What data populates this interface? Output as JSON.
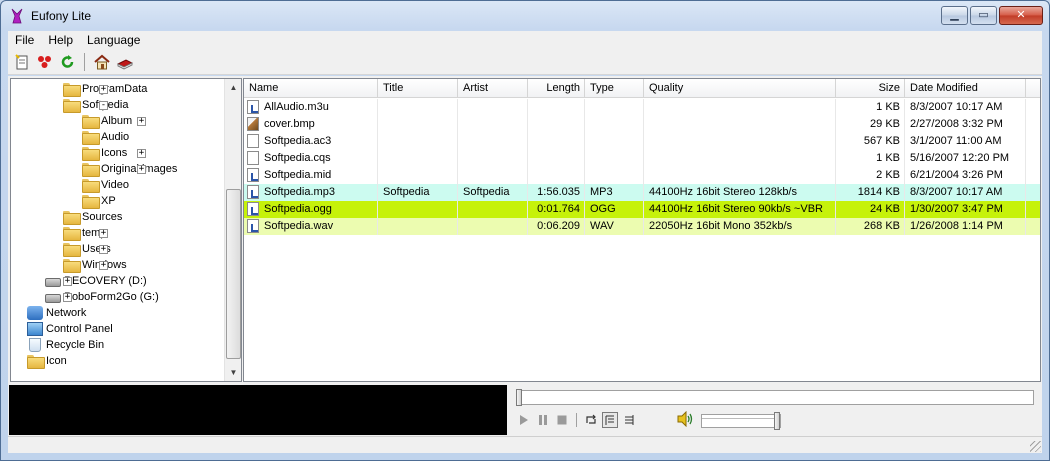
{
  "window": {
    "title": "Eufony Lite",
    "app_icon": "rabbit-icon"
  },
  "menu": [
    "File",
    "Help",
    "Language"
  ],
  "toolbar": [
    {
      "name": "new-playlist-icon"
    },
    {
      "name": "record-dots-icon"
    },
    {
      "name": "refresh-icon"
    },
    {
      "name": "home-icon"
    },
    {
      "name": "book-icon"
    }
  ],
  "tree": [
    {
      "label": "ProgramData",
      "level": 3,
      "icon": "folder",
      "expander": "+"
    },
    {
      "label": "Softpedia",
      "level": 3,
      "icon": "folder",
      "expander": "-"
    },
    {
      "label": "Album",
      "level": 4,
      "icon": "folder",
      "expander": "+"
    },
    {
      "label": "Audio",
      "level": 4,
      "icon": "folder",
      "expander": ""
    },
    {
      "label": "Icons",
      "level": 4,
      "icon": "folder",
      "expander": "+"
    },
    {
      "label": "Original images",
      "level": 4,
      "icon": "folder",
      "expander": "+"
    },
    {
      "label": "Video",
      "level": 4,
      "icon": "folder",
      "expander": ""
    },
    {
      "label": "XP",
      "level": 4,
      "icon": "folder",
      "expander": ""
    },
    {
      "label": "Sources",
      "level": 3,
      "icon": "folder",
      "expander": ""
    },
    {
      "label": "temp",
      "level": 3,
      "icon": "folder",
      "expander": "+"
    },
    {
      "label": "Users",
      "level": 3,
      "icon": "folder",
      "expander": "+"
    },
    {
      "label": "Windows",
      "level": 3,
      "icon": "folder",
      "expander": "+"
    },
    {
      "label": "RECOVERY (D:)",
      "level": 2,
      "icon": "drive",
      "expander": "+"
    },
    {
      "label": "RoboForm2Go (G:)",
      "level": 2,
      "icon": "drive",
      "expander": "+"
    },
    {
      "label": "Network",
      "level": 1,
      "icon": "network",
      "expander": "+"
    },
    {
      "label": "Control Panel",
      "level": 1,
      "icon": "control-panel",
      "expander": "+"
    },
    {
      "label": "Recycle Bin",
      "level": 1,
      "icon": "recycle-bin",
      "expander": ""
    },
    {
      "label": "Icon",
      "level": 1,
      "icon": "folder",
      "expander": ""
    }
  ],
  "columns": [
    "Name",
    "Title",
    "Artist",
    "Length",
    "Type",
    "Quality",
    "Size",
    "Date Modified"
  ],
  "files": [
    {
      "name": "AllAudio.m3u",
      "title": "",
      "artist": "",
      "length": "",
      "type": "",
      "quality": "",
      "size": "1 KB",
      "date": "8/3/2007 10:17 AM",
      "icon": "audio",
      "highlight": ""
    },
    {
      "name": "cover.bmp",
      "title": "",
      "artist": "",
      "length": "",
      "type": "",
      "quality": "",
      "size": "29 KB",
      "date": "2/27/2008 3:32 PM",
      "icon": "image",
      "highlight": ""
    },
    {
      "name": "Softpedia.ac3",
      "title": "",
      "artist": "",
      "length": "",
      "type": "",
      "quality": "",
      "size": "567 KB",
      "date": "3/1/2007 11:00 AM",
      "icon": "blank",
      "highlight": ""
    },
    {
      "name": "Softpedia.cqs",
      "title": "",
      "artist": "",
      "length": "",
      "type": "",
      "quality": "",
      "size": "1 KB",
      "date": "5/16/2007 12:20 PM",
      "icon": "blank",
      "highlight": ""
    },
    {
      "name": "Softpedia.mid",
      "title": "",
      "artist": "",
      "length": "",
      "type": "",
      "quality": "",
      "size": "2 KB",
      "date": "6/21/2004 3:26 PM",
      "icon": "audio",
      "highlight": ""
    },
    {
      "name": "Softpedia.mp3",
      "title": "Softpedia",
      "artist": "Softpedia",
      "length": "1:56.035",
      "type": "MP3",
      "quality": "44100Hz 16bit Stereo 128kb/s",
      "size": "1814 KB",
      "date": "8/3/2007 10:17 AM",
      "icon": "audio",
      "highlight": "#ccfbf0"
    },
    {
      "name": "Softpedia.ogg",
      "title": "",
      "artist": "",
      "length": "0:01.764",
      "type": "OGG",
      "quality": "44100Hz 16bit Stereo 90kb/s ~VBR",
      "size": "24 KB",
      "date": "1/30/2007 3:47 PM",
      "icon": "audio",
      "highlight": "#c6f20a"
    },
    {
      "name": "Softpedia.wav",
      "title": "",
      "artist": "",
      "length": "0:06.209",
      "type": "WAV",
      "quality": "22050Hz 16bit Mono 352kb/s",
      "size": "268 KB",
      "date": "1/26/2008 1:14 PM",
      "icon": "audio",
      "highlight": "#ecfcb0"
    }
  ],
  "player": {
    "seek_position": 0,
    "volume": 1.0,
    "controls": [
      "play-icon",
      "pause-icon",
      "stop-icon",
      "repeat-icon",
      "playlist-icon",
      "playlist-alt-icon"
    ]
  }
}
